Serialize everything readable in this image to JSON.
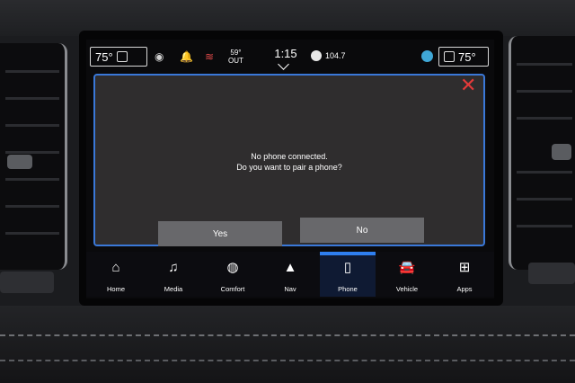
{
  "status_bar": {
    "left_temp": "75°",
    "right_temp": "75°",
    "outside_temp": "59°",
    "outside_label": "OUT",
    "clock": "1:15",
    "radio_frequency": "104.7"
  },
  "dialog": {
    "line1": "No phone connected.",
    "line2": "Do you want to pair a phone?",
    "yes_label": "Yes",
    "no_label": "No"
  },
  "nav": {
    "items": [
      {
        "label": "Home",
        "icon": "home-icon"
      },
      {
        "label": "Media",
        "icon": "music-note-icon"
      },
      {
        "label": "Comfort",
        "icon": "comfort-icon"
      },
      {
        "label": "Nav",
        "icon": "navigation-icon"
      },
      {
        "label": "Phone",
        "icon": "phone-icon",
        "active": true
      },
      {
        "label": "Vehicle",
        "icon": "vehicle-icon"
      },
      {
        "label": "Apps",
        "icon": "apps-grid-icon"
      }
    ]
  },
  "colors": {
    "dialog_border": "#3a78d8",
    "close_icon": "#e33a3a",
    "active_tab": "#2f7ff0"
  }
}
